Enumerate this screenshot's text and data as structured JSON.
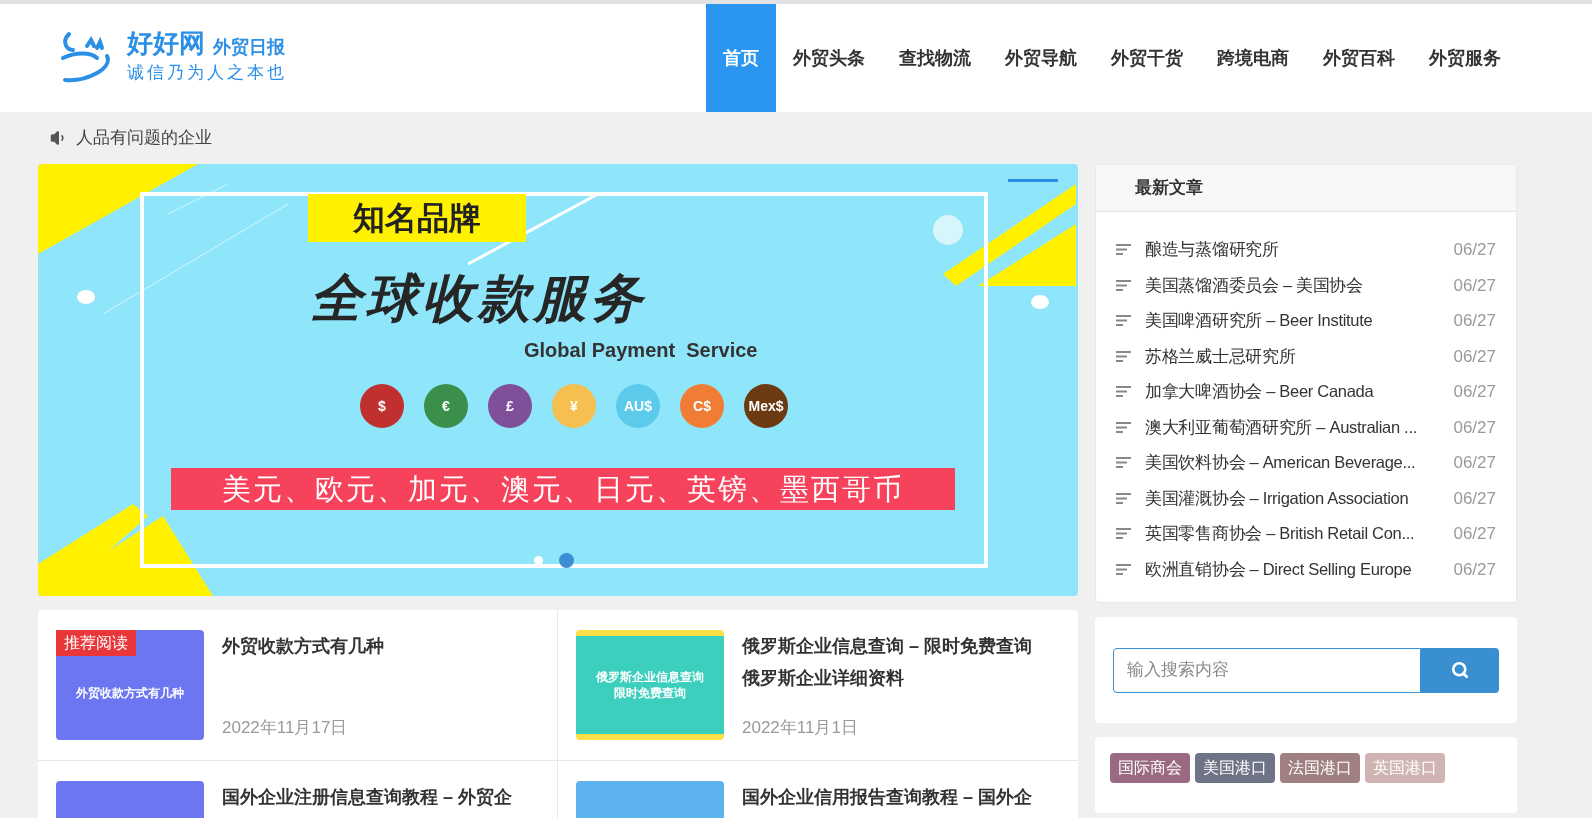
{
  "logo": {
    "name": "好好网",
    "subtitle": "外贸日报",
    "slogan": "诚信乃为人之本也"
  },
  "nav": [
    {
      "label": "首页",
      "selected": true
    },
    {
      "label": "外贸头条",
      "selected": false
    },
    {
      "label": "查找物流",
      "selected": false
    },
    {
      "label": "外贸导航",
      "selected": false
    },
    {
      "label": "外贸干货",
      "selected": false
    },
    {
      "label": "跨境电商",
      "selected": false
    },
    {
      "label": "外贸百科",
      "selected": false
    },
    {
      "label": "外贸服务",
      "selected": false
    }
  ],
  "notice": "人品有问题的企业",
  "banner": {
    "tag": "知名品牌",
    "headline": "全球收款服务",
    "subheadline": "Global Payment  Service",
    "currencies": [
      {
        "symbol": "$",
        "color": "#c0302f"
      },
      {
        "symbol": "€",
        "color": "#3a8f4a"
      },
      {
        "symbol": "£",
        "color": "#7f4f9a"
      },
      {
        "symbol": "¥",
        "color": "#f5c04f"
      },
      {
        "symbol": "AU$",
        "color": "#5ccbeb"
      },
      {
        "symbol": "C$",
        "color": "#f07c36"
      },
      {
        "symbol": "Mex$",
        "color": "#6b3a12"
      }
    ],
    "strip": "美元、欧元、加元、澳元、日元、英镑、墨西哥币",
    "dots": [
      {
        "selected": false
      },
      {
        "selected": true
      }
    ]
  },
  "articles": [
    {
      "kind": "plain",
      "title": "外贸收款方式有几种",
      "date": "2022年11月17日",
      "badge": "推荐阅读",
      "thumb_title": "外贸收款方式有几种"
    },
    {
      "kind": "promo",
      "title": "俄罗斯企业信息查询 – 限时免费查询俄罗斯企业详细资料",
      "date": "2022年11月1日",
      "thumb_title": "俄罗斯企业信息查询",
      "thumb_subtitle": "限时免费查询"
    },
    {
      "kind": "plain",
      "title": "国外企业注册信息查询教程 – 外贸企"
    },
    {
      "kind": "light",
      "title": "国外企业信用报告查询教程 – 国外企"
    }
  ],
  "latest": {
    "title": "最新文章",
    "items": [
      {
        "title": "酿造与蒸馏研究所",
        "date": "06/27"
      },
      {
        "title": "美国蒸馏酒委员会 – 美国协会",
        "date": "06/27"
      },
      {
        "title": "美国啤酒研究所 – Beer Institute",
        "date": "06/27"
      },
      {
        "title": "苏格兰威士忌研究所",
        "date": "06/27"
      },
      {
        "title": "加拿大啤酒协会 – Beer Canada",
        "date": "06/27"
      },
      {
        "title": "澳大利亚葡萄酒研究所 – Australian ...",
        "date": "06/27"
      },
      {
        "title": "美国饮料协会 – American Beverage...",
        "date": "06/27"
      },
      {
        "title": "美国灌溉协会 – Irrigation Association",
        "date": "06/27"
      },
      {
        "title": "英国零售商协会 – British Retail Con...",
        "date": "06/27"
      },
      {
        "title": "欧洲直销协会 – Direct Selling Europe",
        "date": "06/27"
      }
    ]
  },
  "search": {
    "placeholder": "输入搜索内容"
  },
  "tags": [
    {
      "label": "国际商会",
      "color": "#9a6a82"
    },
    {
      "label": "美国港口",
      "color": "#6e7385"
    },
    {
      "label": "法国港口",
      "color": "#a07f80"
    },
    {
      "label": "英国港口",
      "color": "#cfb4b3"
    }
  ]
}
